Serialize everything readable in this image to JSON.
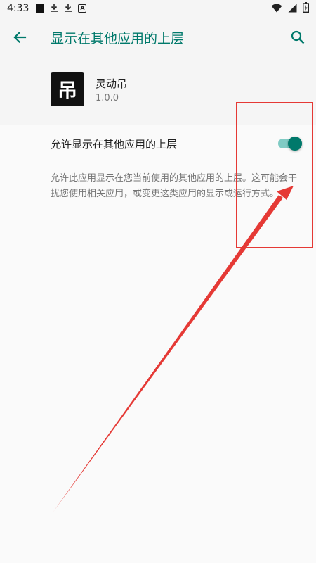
{
  "status_bar": {
    "time": "4:33",
    "icons_left": [
      "stop-square-icon",
      "download-icon",
      "download-icon",
      "a-icon"
    ],
    "icons_right": [
      "wifi-icon",
      "signal-icon",
      "battery-icon"
    ]
  },
  "app_bar": {
    "title": "显示在其他应用的上层",
    "back_icon": "arrow-left-icon",
    "search_icon": "search-icon"
  },
  "app": {
    "icon_glyph": "吊",
    "name": "灵动吊",
    "version": "1.0.0"
  },
  "setting": {
    "label": "允许显示在其他应用的上层",
    "enabled": true,
    "description": "允许此应用显示在您当前使用的其他应用的上层。这可能会干扰您使用相关应用，或变更这类应用的显示或运行方式。"
  },
  "colors": {
    "accent": "#00796b",
    "track": "#80cbc4",
    "annotation": "#e53935",
    "header_bg": "#f5f5f5",
    "page_bg": "#fafafa"
  }
}
